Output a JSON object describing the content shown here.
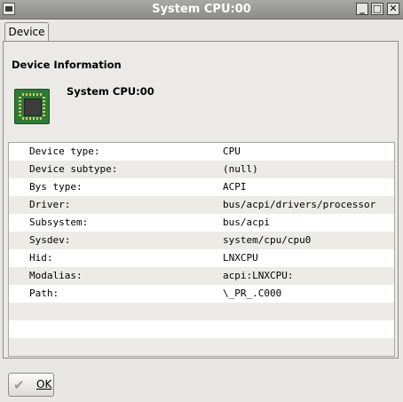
{
  "window": {
    "title": "System CPU:00"
  },
  "tabs": [
    {
      "label": "Device"
    }
  ],
  "section": {
    "title": "Device Information"
  },
  "device": {
    "name": "System CPU:00",
    "icon": "cpu-chip-icon"
  },
  "properties": [
    {
      "key": "Device type:",
      "value": "CPU"
    },
    {
      "key": "Device subtype:",
      "value": "(null)"
    },
    {
      "key": "Bys type:",
      "value": "ACPI"
    },
    {
      "key": "Driver:",
      "value": "bus/acpi/drivers/processor"
    },
    {
      "key": "Subsystem:",
      "value": "bus/acpi"
    },
    {
      "key": "Sysdev:",
      "value": "system/cpu/cpu0"
    },
    {
      "key": "Hid:",
      "value": "LNXCPU"
    },
    {
      "key": "Modalias:",
      "value": "acpi:LNXCPU:"
    },
    {
      "key": "Path:",
      "value": "\\_PR_.C000"
    }
  ],
  "buttons": {
    "ok_label": "OK"
  }
}
